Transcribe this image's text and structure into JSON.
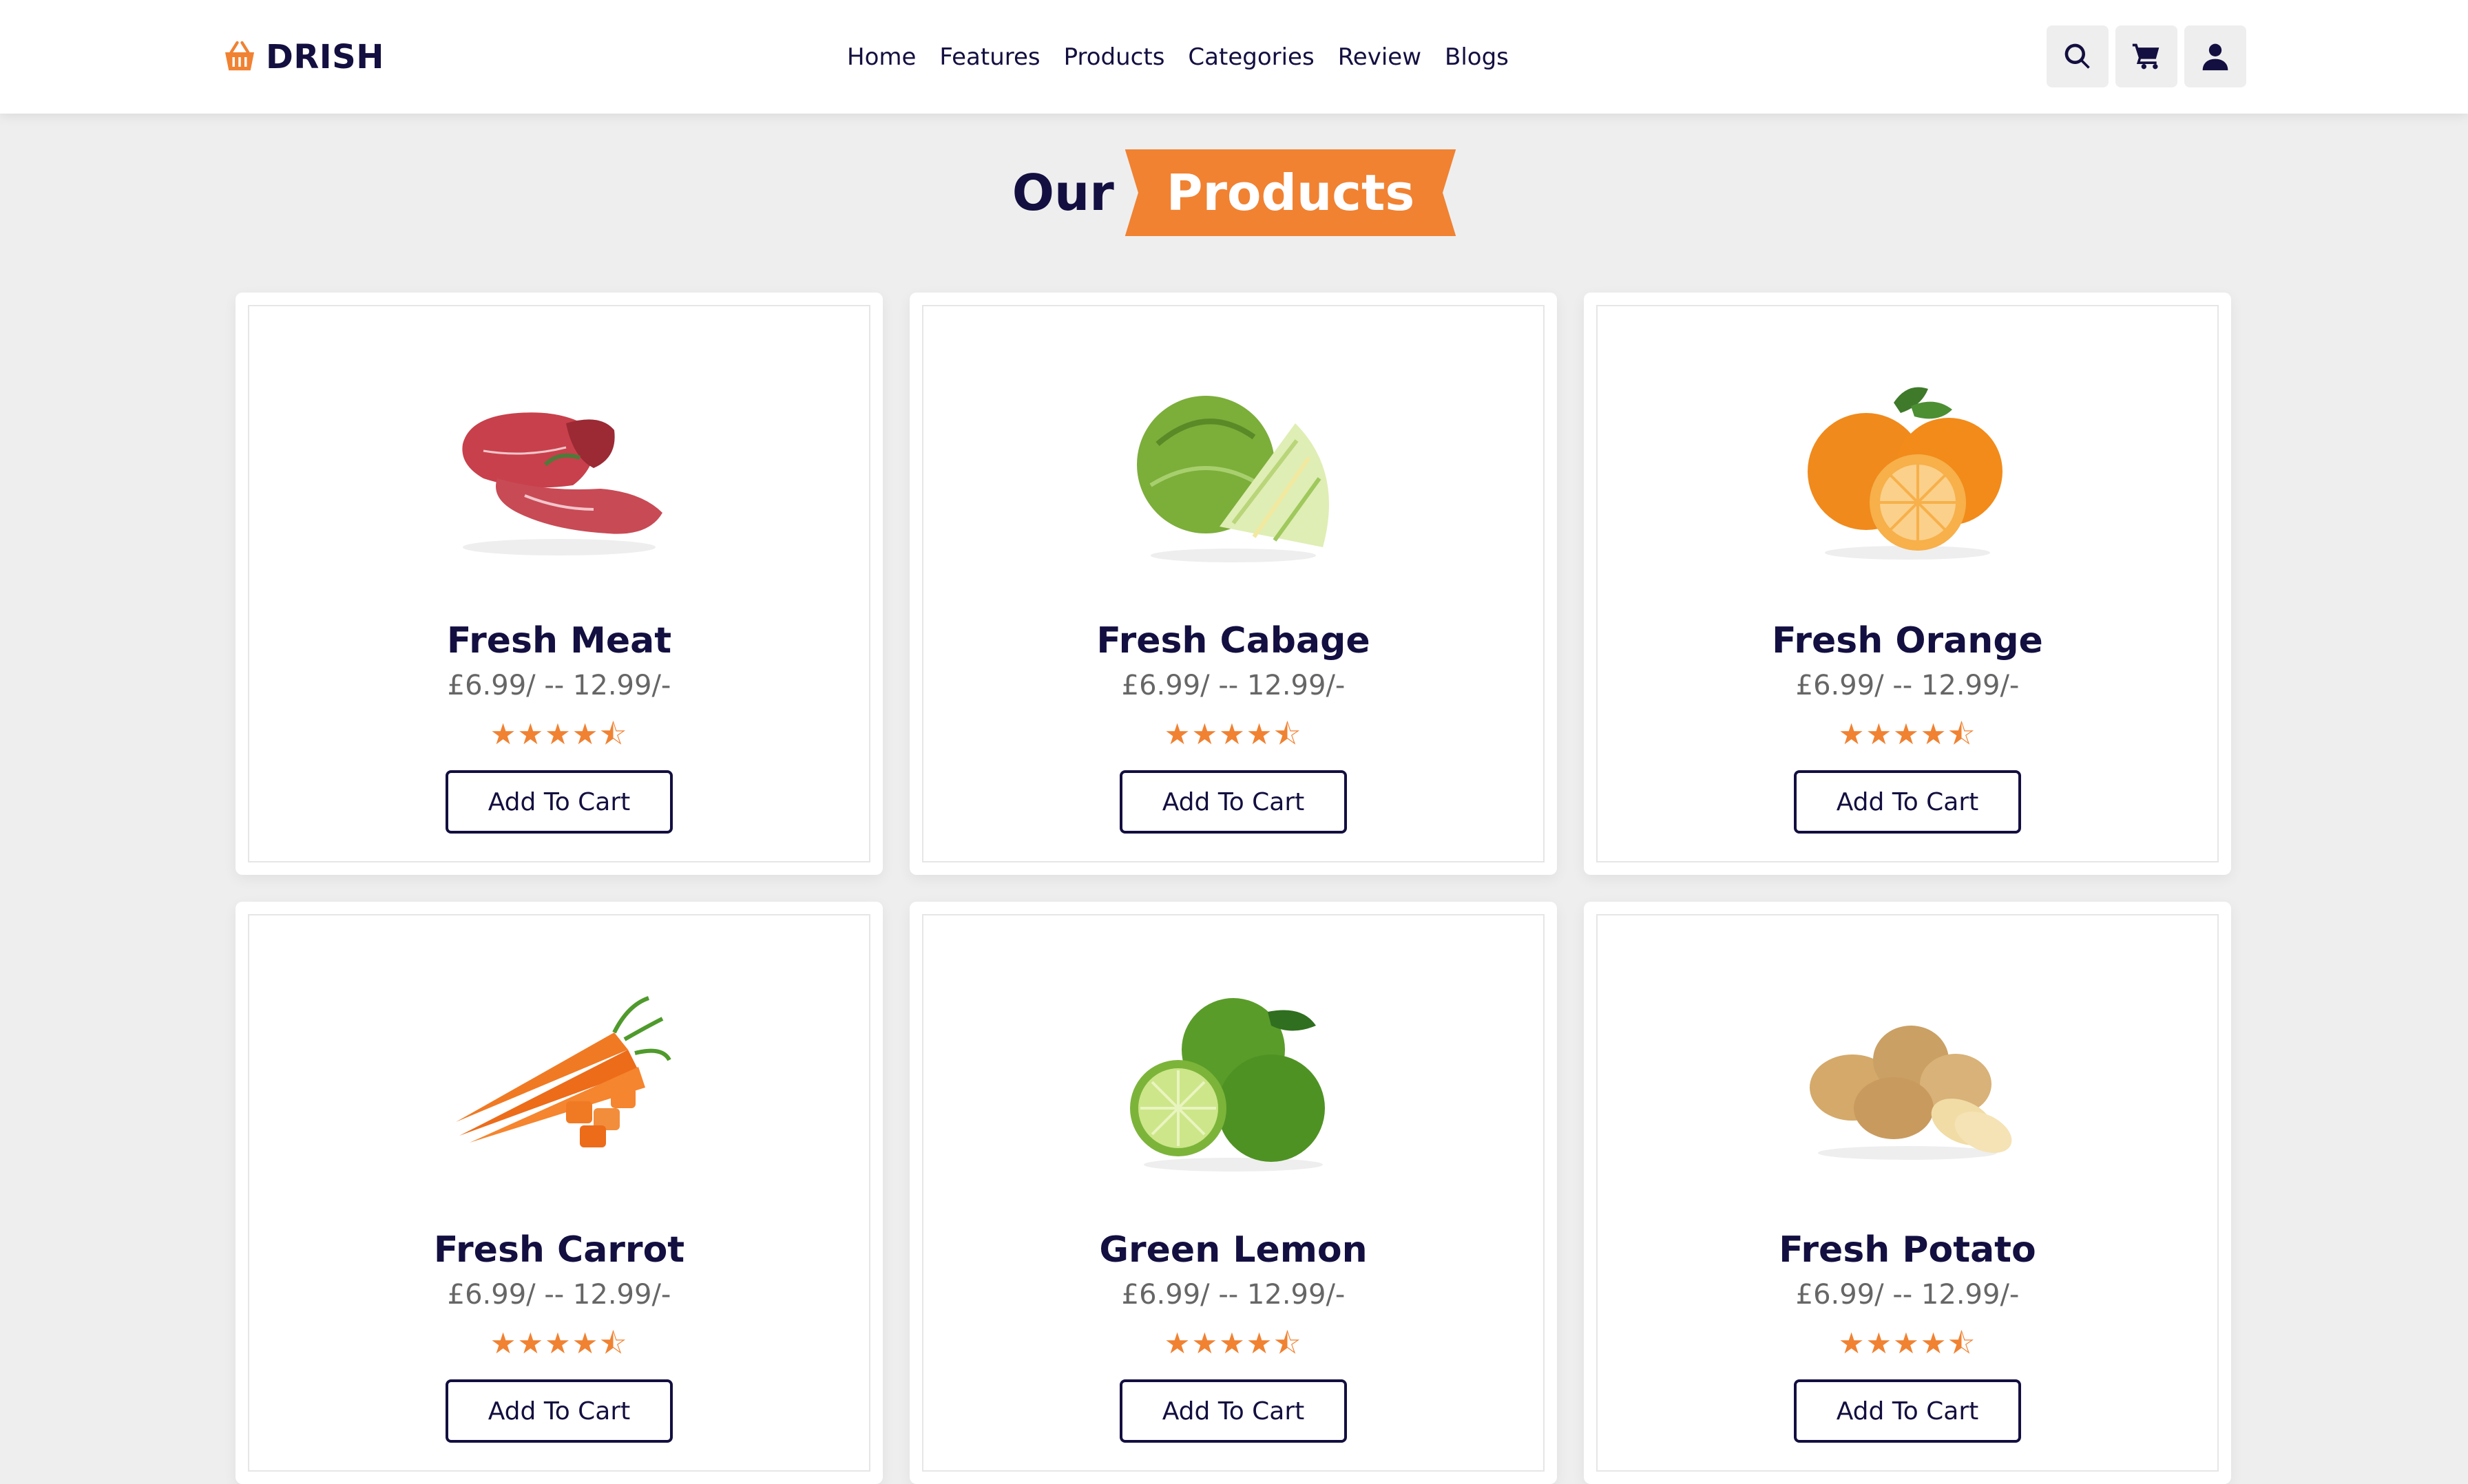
{
  "header": {
    "logo_text": "DRISH",
    "nav": [
      "Home",
      "Features",
      "Products",
      "Categories",
      "Review",
      "Blogs"
    ],
    "icons": [
      "search-icon",
      "cart-icon",
      "user-icon"
    ]
  },
  "heading": {
    "word1": "Our",
    "word2": "Products"
  },
  "colors": {
    "accent": "#f08232",
    "navy": "#130f40",
    "bg": "#eeeeee"
  },
  "products": [
    {
      "name": "Fresh Meat",
      "price": "£6.99/ -- 12.99/-",
      "rating": "★★★★⯪",
      "button": "Add To Cart",
      "image": "meat"
    },
    {
      "name": "Fresh Cabage",
      "price": "£6.99/ -- 12.99/-",
      "rating": "★★★★⯪",
      "button": "Add To Cart",
      "image": "cabbage"
    },
    {
      "name": "Fresh Orange",
      "price": "£6.99/ -- 12.99/-",
      "rating": "★★★★⯪",
      "button": "Add To Cart",
      "image": "orange"
    },
    {
      "name": "Fresh Carrot",
      "price": "£6.99/ -- 12.99/-",
      "rating": "★★★★⯪",
      "button": "Add To Cart",
      "image": "carrot"
    },
    {
      "name": "Green Lemon",
      "price": "£6.99/ -- 12.99/-",
      "rating": "★★★★⯪",
      "button": "Add To Cart",
      "image": "lemon"
    },
    {
      "name": "Fresh Potato",
      "price": "£6.99/ -- 12.99/-",
      "rating": "★★★★⯪",
      "button": "Add To Cart",
      "image": "potato"
    }
  ]
}
